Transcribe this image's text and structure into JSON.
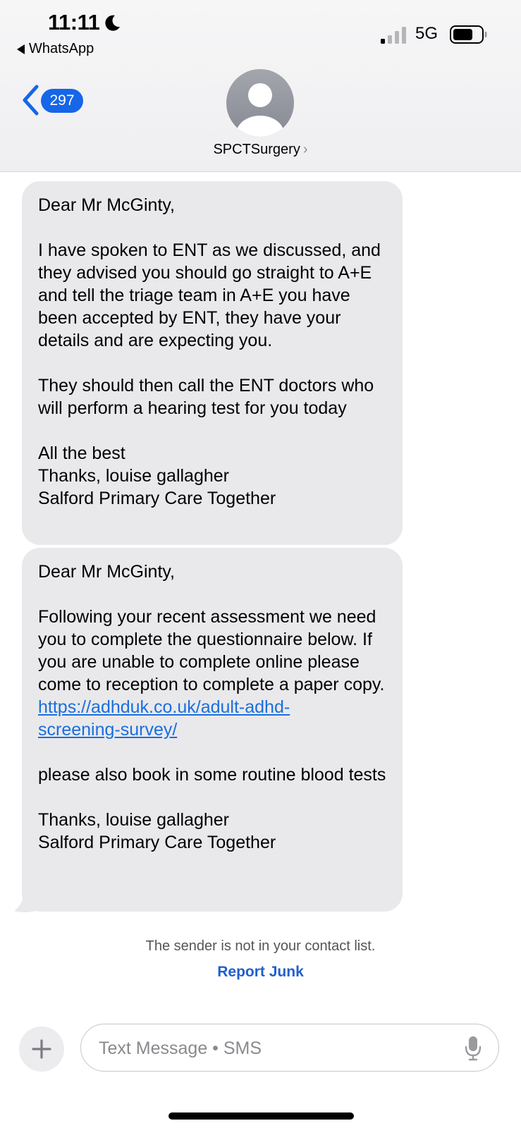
{
  "status_bar": {
    "time": "11:11",
    "back_app_label": "WhatsApp",
    "network": "5G"
  },
  "nav": {
    "unread_count": "297",
    "contact_name": "SPCTSurgery",
    "contact_chevron": "›",
    "icons": [
      "moon-icon",
      "signal-icon",
      "battery-icon",
      "back-chevron-icon",
      "avatar-icon"
    ]
  },
  "messages": [
    {
      "greeting": "Dear Mr McGinty,",
      "body1": "I have spoken to ENT as we discussed, and they advised you should go straight to A+E and tell the triage team in A+E you have been accepted by ENT, they have your details and are expecting you.",
      "body2": "They should then call the ENT doctors who will perform a hearing test for you today",
      "signoff1": "All the best",
      "signoff2": "Thanks, louise gallagher",
      "signoff3": "Salford Primary Care Together"
    },
    {
      "greeting": "Dear Mr McGinty,",
      "body1": "Following your recent assessment we need you to complete the  questionnaire below. If you are unable to complete online please come to reception to complete a paper copy.",
      "link_line1": "https://adhduk.co.uk/adult-adhd-",
      "link_line2": "screening-survey/",
      "body2": "please also book in some routine blood tests",
      "signoff1": "Thanks, louise gallagher",
      "signoff2": "Salford Primary Care Together"
    }
  ],
  "footer": {
    "notice": "The sender is not in your contact list.",
    "report_junk": "Report Junk"
  },
  "composer": {
    "placeholder": "Text Message • SMS",
    "value": ""
  },
  "colors": {
    "accent": "#1566e8",
    "bubble": "#e9e9eb",
    "link": "#1a6ee0"
  }
}
